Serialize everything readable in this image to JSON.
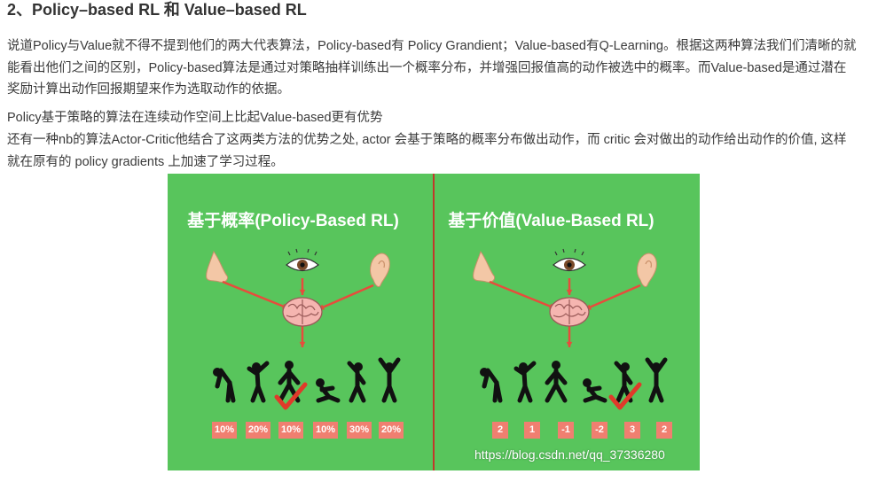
{
  "heading": "2、Policy–based RL 和 Value–based RL",
  "paragraph1": "说道Policy与Value就不得不提到他们的两大代表算法，Policy-based有 Policy Grandient；Value-based有Q-Learning。根据这两种算法我们们清晰的就能看出他们之间的区别，Policy-based算法是通过对策略抽样训练出一个概率分布，并增强回报值高的动作被选中的概率。而Value-based是通过潜在奖励计算出动作回报期望来作为选取动作的依据。",
  "paragraph2": "Policy基于策略的算法在连续动作空间上比起Value-based更有优势",
  "paragraph3": "还有一种nb的算法Actor-Critic他结合了这两类方法的优势之处, actor 会基于策略的概率分布做出动作，而 critic 会对做出的动作给出动作的价值, 这样就在原有的 policy gradients 上加速了学习过程。",
  "figure": {
    "left_title": "基于概率(Policy-Based RL)",
    "right_title": "基于价值(Value-Based RL)",
    "left_values": [
      "10%",
      "20%",
      "10%",
      "10%",
      "30%",
      "20%"
    ],
    "right_values": [
      "2",
      "1",
      "-1",
      "-2",
      "3",
      "2"
    ],
    "left_checked_index": 2,
    "right_checked_index": 4,
    "watermark": "https://blog.csdn.net/qq_37336280",
    "colors": {
      "background": "#58c55c",
      "arrow": "#e74c3c",
      "badge": "#f07f70",
      "divider": "#c0392b"
    },
    "icons": [
      "nose-icon",
      "eye-icon",
      "ear-icon",
      "brain-icon",
      "person-pose-icon",
      "check-mark-icon"
    ]
  }
}
